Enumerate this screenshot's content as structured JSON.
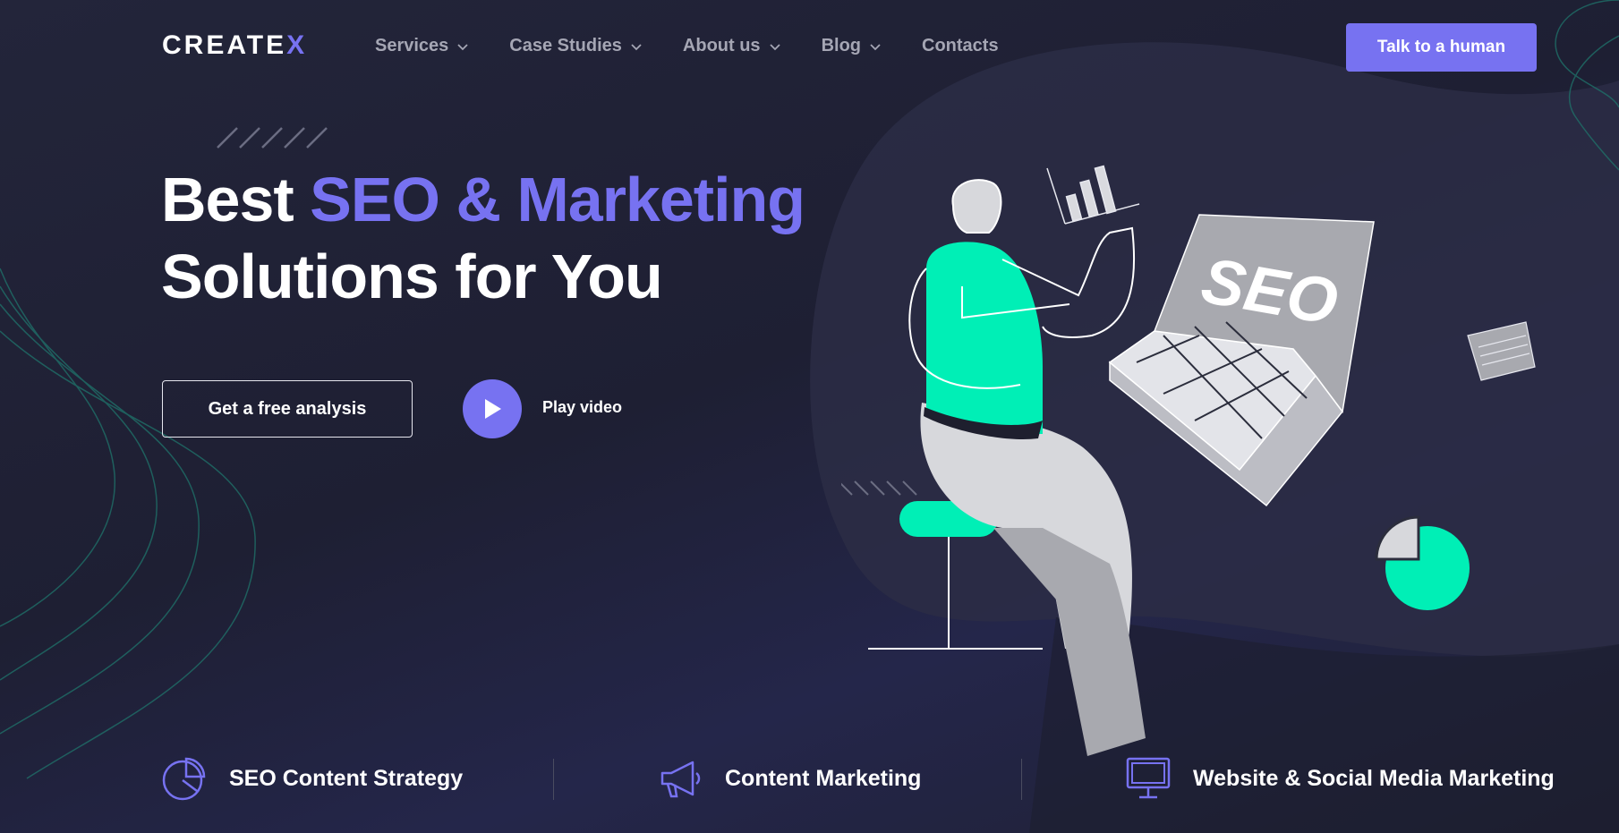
{
  "brand": {
    "logo_main": "CREATE",
    "logo_x": "X"
  },
  "nav": {
    "items": [
      {
        "label": "Services",
        "has_dropdown": true
      },
      {
        "label": "Case Studies",
        "has_dropdown": true
      },
      {
        "label": "About us",
        "has_dropdown": true
      },
      {
        "label": "Blog",
        "has_dropdown": true
      },
      {
        "label": "Contacts",
        "has_dropdown": false
      }
    ],
    "cta_label": "Talk to a human"
  },
  "hero": {
    "title_part1": "Best ",
    "title_accent": "SEO & Marketing",
    "title_line2": "Solutions for You",
    "primary_button": "Get a free analysis",
    "play_label": "Play video"
  },
  "illustration": {
    "screen_text": "SEO"
  },
  "features": [
    {
      "label": "SEO Content Strategy",
      "icon": "pie-chart-icon"
    },
    {
      "label": "Content Marketing",
      "icon": "megaphone-icon"
    },
    {
      "label": "Website & Social Media Marketing",
      "icon": "monitor-icon"
    }
  ],
  "colors": {
    "accent": "#7772f1",
    "mint": "#00efb6",
    "background": "#1f2032",
    "nav_text": "#a5a6b4"
  }
}
